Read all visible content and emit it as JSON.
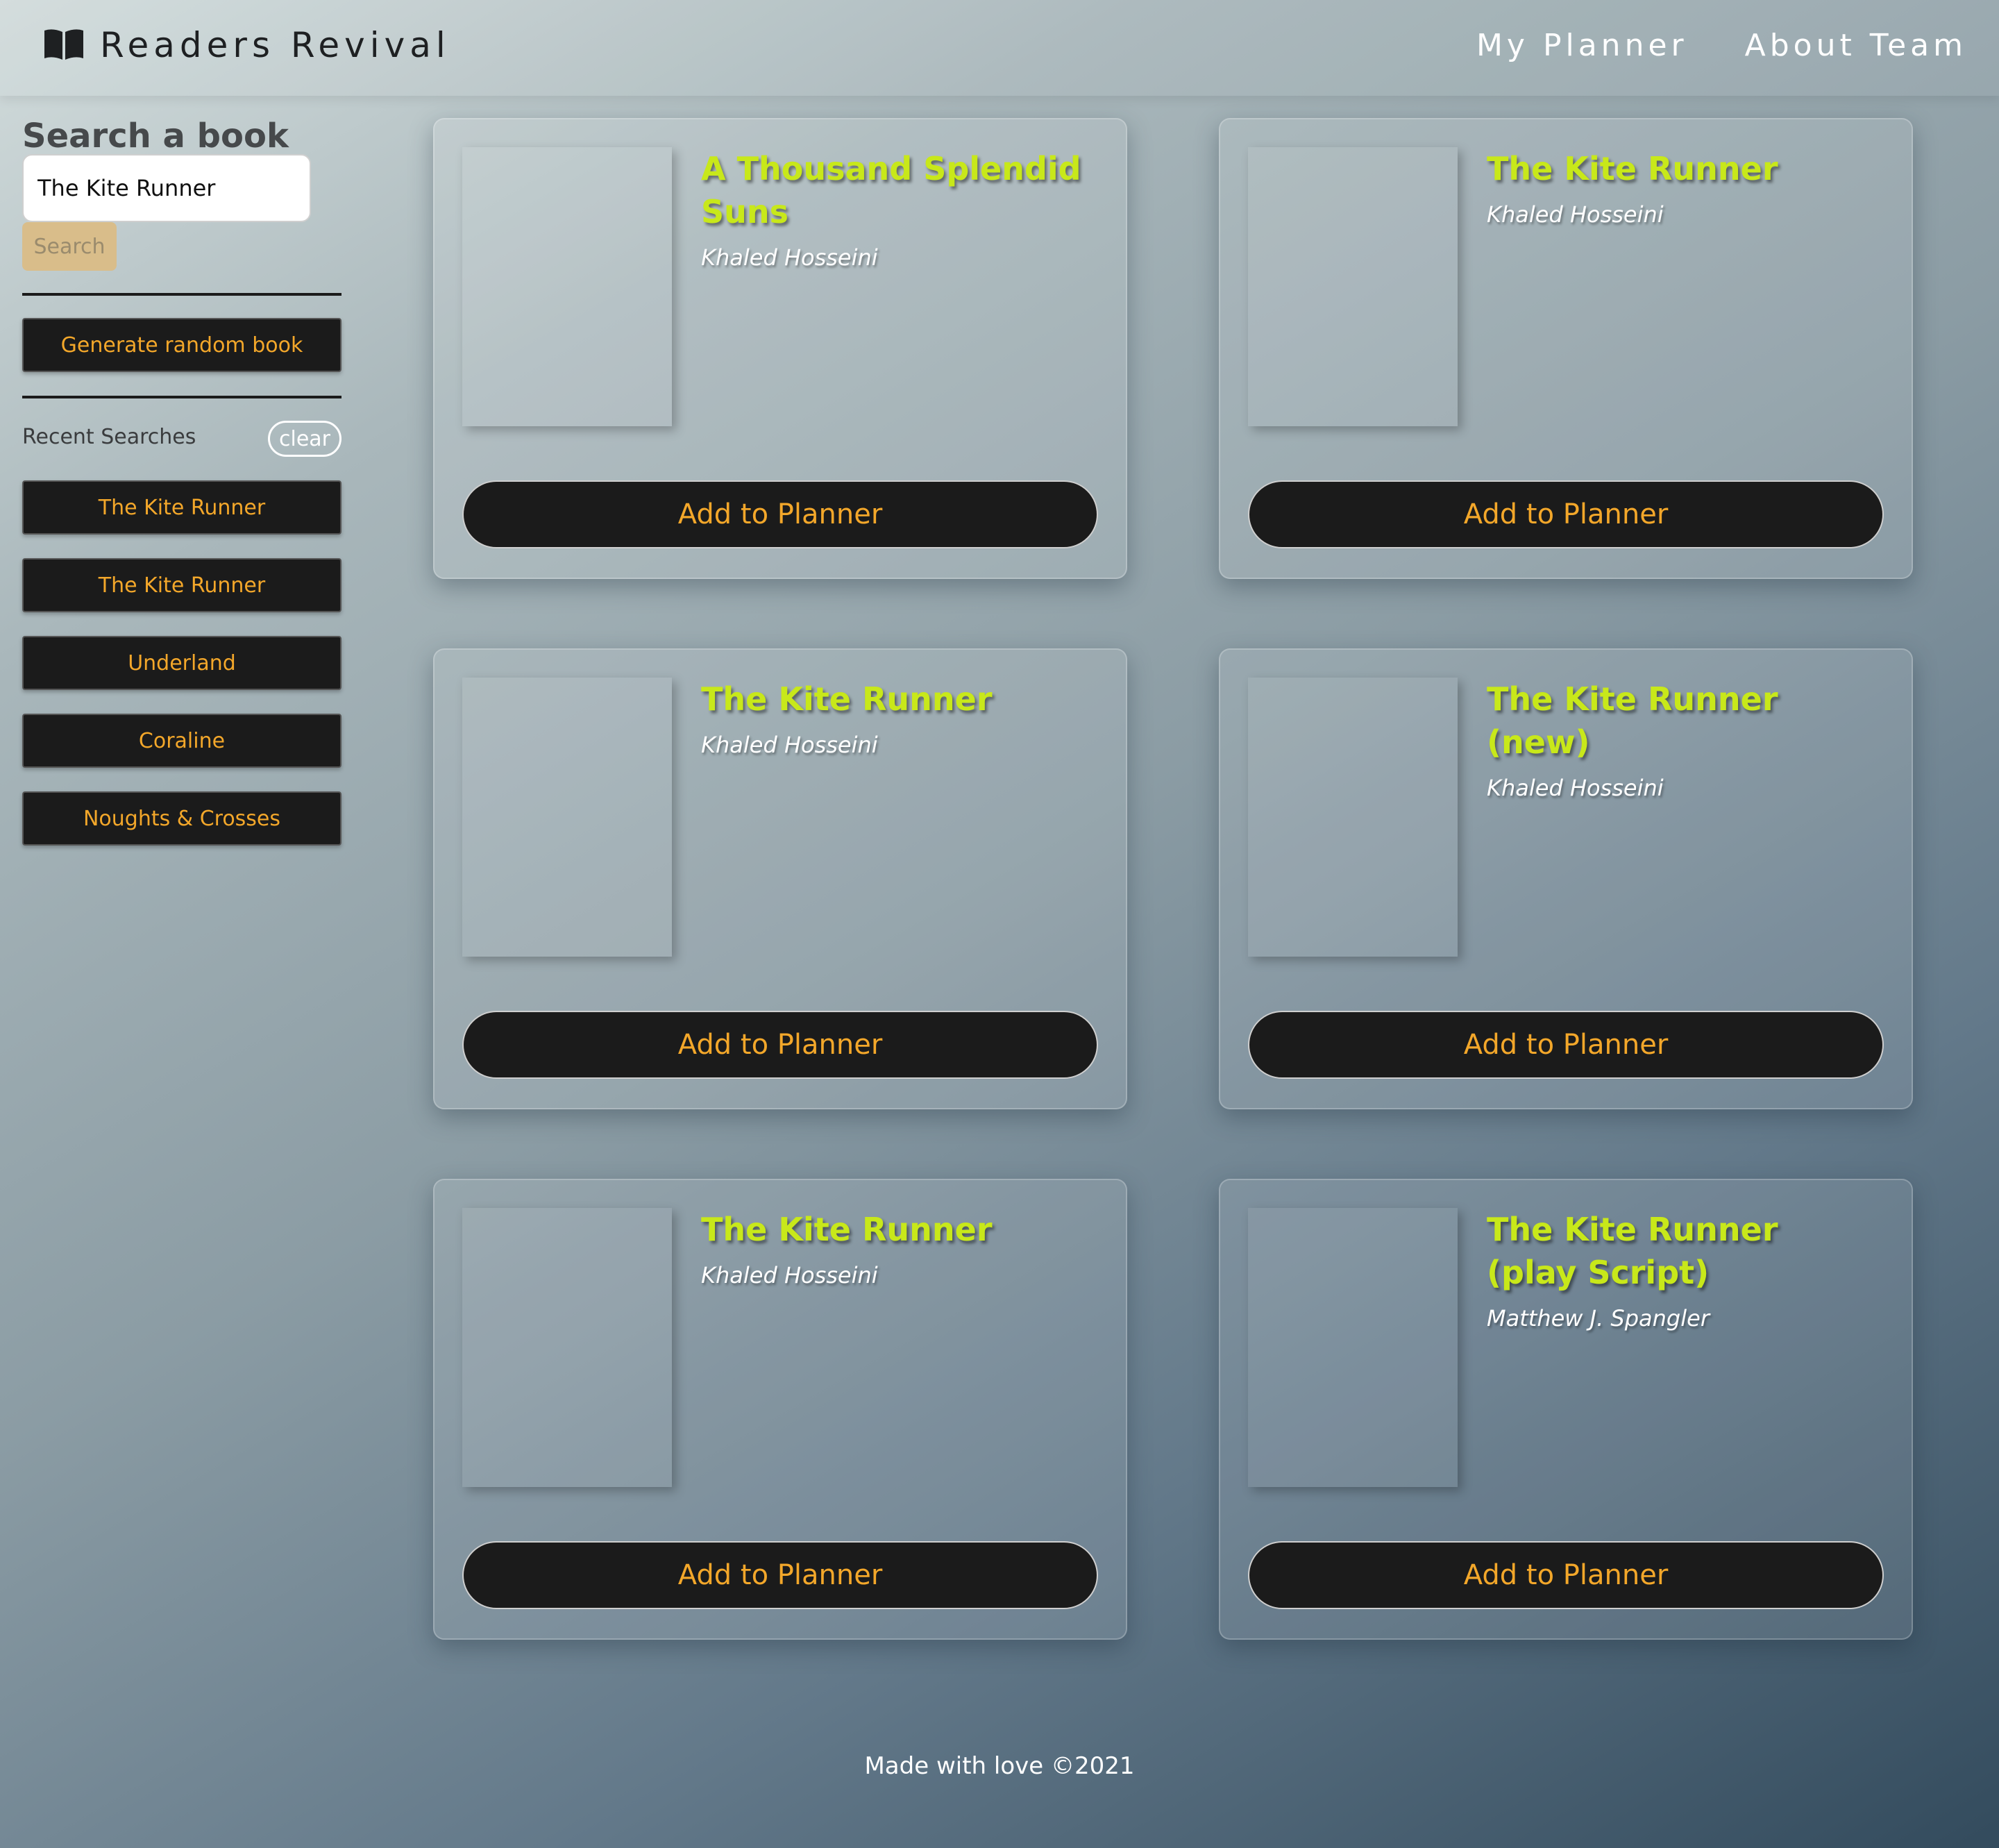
{
  "header": {
    "brand_icon": "book-open-icon",
    "title": "Readers Revival",
    "nav": [
      {
        "label": "My Planner"
      },
      {
        "label": "About Team"
      }
    ]
  },
  "sidebar": {
    "heading": "Search a book",
    "search_value": "The Kite Runner",
    "search_button": "Search",
    "random_button": "Generate random book",
    "recent_label": "Recent Searches",
    "clear_label": "clear",
    "recent": [
      {
        "label": "The Kite Runner"
      },
      {
        "label": "The Kite Runner"
      },
      {
        "label": "Underland"
      },
      {
        "label": "Coraline"
      },
      {
        "label": "Noughts & Crosses"
      }
    ]
  },
  "books": [
    {
      "title": "A Thousand Splendid Suns",
      "author": "Khaled Hosseini",
      "action": "Add to Planner"
    },
    {
      "title": "The Kite Runner",
      "author": "Khaled Hosseini",
      "action": "Add to Planner"
    },
    {
      "title": "The Kite Runner",
      "author": "Khaled Hosseini",
      "action": "Add to Planner"
    },
    {
      "title": "The Kite Runner (new)",
      "author": "Khaled Hosseini",
      "action": "Add to Planner"
    },
    {
      "title": "The Kite Runner",
      "author": "Khaled Hosseini",
      "action": "Add to Planner"
    },
    {
      "title": "The Kite Runner (play Script)",
      "author": "Matthew J. Spangler",
      "action": "Add to Planner"
    }
  ],
  "footer": {
    "text": "Made with love ©2021"
  },
  "colors": {
    "title_accent": "#c8e81a",
    "button_text": "#f3a72a",
    "button_bg": "#1b1b1b",
    "search_button_bg": "#d9bd8a"
  }
}
